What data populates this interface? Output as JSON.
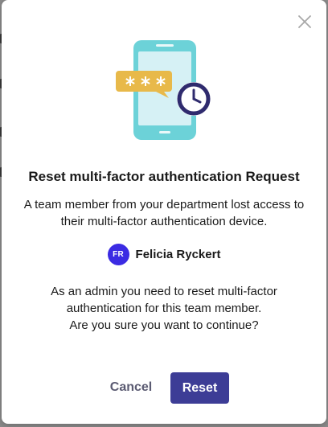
{
  "dialog": {
    "title": "Reset multi-factor authentication Request",
    "description": "A team member from your department lost access to their multi-factor authentication device.",
    "user": {
      "initials": "FR",
      "name": "Felicia Ryckert",
      "avatar_color": "#3b2be3"
    },
    "confirmation": [
      "As an admin you need to reset multi-factor",
      "authentication for this team member.",
      "Are you sure you want to continue?"
    ],
    "cancel_label": "Cancel",
    "reset_label": "Reset",
    "close_icon": "close-icon",
    "illustration_icon": "phone-mfa-illustration"
  },
  "colors": {
    "primary_button": "#3d3d96",
    "phone": "#6cd2d8",
    "clock": "#2f2b6e",
    "bubble": "#e8b94a",
    "backdrop": "#8c8c8c"
  }
}
